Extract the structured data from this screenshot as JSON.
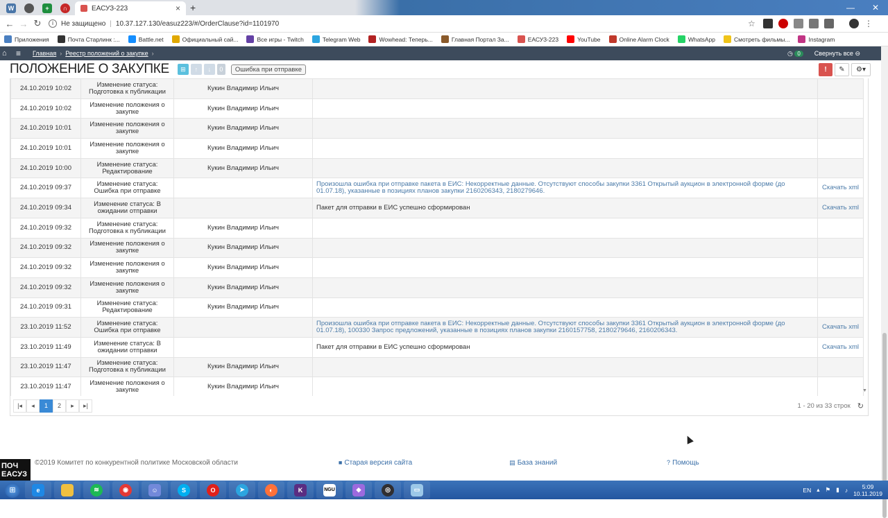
{
  "browser": {
    "active_tab_title": "ЕАСУЗ-223",
    "address_secure": "Не защищено",
    "address_url": "10.37.127.130/easuz223/#/OrderClause?id=1101970"
  },
  "bookmarks": [
    {
      "label": "Приложения",
      "color": "#4a7fc0"
    },
    {
      "label": "Почта Старлинк :...",
      "color": "#333"
    },
    {
      "label": "Battle.net",
      "color": "#148eff"
    },
    {
      "label": "Официальный сай...",
      "color": "#e0a800"
    },
    {
      "label": "Все игры - Twitch",
      "color": "#6441a5"
    },
    {
      "label": "Telegram Web",
      "color": "#2ca5e0"
    },
    {
      "label": "Wowhead: Теперь...",
      "color": "#b22222"
    },
    {
      "label": "Главная Портал За...",
      "color": "#8a5a2b"
    },
    {
      "label": "ЕАСУЗ-223",
      "color": "#d9534f"
    },
    {
      "label": "YouTube",
      "color": "#ff0000"
    },
    {
      "label": "Online Alarm Clock",
      "color": "#c0392b"
    },
    {
      "label": "WhatsApp",
      "color": "#25d366"
    },
    {
      "label": "Смотреть фильмы...",
      "color": "#f0c419"
    },
    {
      "label": "Instagram",
      "color": "#c13584"
    }
  ],
  "app_nav": {
    "crumb_home": "Главная",
    "crumb_registry": "Реестр положений о закупке",
    "counter": "0",
    "collapse_all": "Свернуть все"
  },
  "page": {
    "title": "ПОЛОЖЕНИЕ О ЗАКУПКЕ",
    "status": "Ошибка при отправке"
  },
  "table": {
    "rows": [
      {
        "date": "24.10.2019 10:02",
        "action": "Изменение статуса: Подготовка к публикации",
        "user": "Кукин Владимир Ильич",
        "message": "",
        "download": ""
      },
      {
        "date": "24.10.2019 10:02",
        "action": "Изменение положения о закупке",
        "user": "Кукин Владимир Ильич",
        "message": "",
        "download": ""
      },
      {
        "date": "24.10.2019 10:01",
        "action": "Изменение положения о закупке",
        "user": "Кукин Владимир Ильич",
        "message": "",
        "download": ""
      },
      {
        "date": "24.10.2019 10:01",
        "action": "Изменение положения о закупке",
        "user": "Кукин Владимир Ильич",
        "message": "",
        "download": ""
      },
      {
        "date": "24.10.2019 10:00",
        "action": "Изменение статуса: Редактирование",
        "user": "Кукин Владимир Ильич",
        "message": "",
        "download": ""
      },
      {
        "date": "24.10.2019 09:37",
        "action": "Изменение статуса: Ошибка при отправке",
        "user": "",
        "message": "Произошла ошибка при отправке пакета в ЕИС: Некорректные данные. Отсутствуют способы закупки 3361 Открытый аукцион в электронной форме (до 01.07.18), указанные в позициях планов закупки 2160206343, 2180279646.",
        "download": "Скачать xml"
      },
      {
        "date": "24.10.2019 09:34",
        "action": "Изменение статуса: В ожидании отправки",
        "user": "",
        "message": "Пакет для отправки в ЕИС успешно сформирован",
        "download": "Скачать xml"
      },
      {
        "date": "24.10.2019 09:32",
        "action": "Изменение статуса: Подготовка к публикации",
        "user": "Кукин Владимир Ильич",
        "message": "",
        "download": ""
      },
      {
        "date": "24.10.2019 09:32",
        "action": "Изменение положения о закупке",
        "user": "Кукин Владимир Ильич",
        "message": "",
        "download": ""
      },
      {
        "date": "24.10.2019 09:32",
        "action": "Изменение положения о закупке",
        "user": "Кукин Владимир Ильич",
        "message": "",
        "download": ""
      },
      {
        "date": "24.10.2019 09:32",
        "action": "Изменение положения о закупке",
        "user": "Кукин Владимир Ильич",
        "message": "",
        "download": ""
      },
      {
        "date": "24.10.2019 09:31",
        "action": "Изменение статуса: Редактирование",
        "user": "Кукин Владимир Ильич",
        "message": "",
        "download": ""
      },
      {
        "date": "23.10.2019 11:52",
        "action": "Изменение статуса: Ошибка при отправке",
        "user": "",
        "message": "Произошла ошибка при отправке пакета в ЕИС: Некорректные данные. Отсутствуют способы закупки 3361 Открытый аукцион в электронной форме (до 01.07.18), 100330 Запрос предложений, указанные в позициях планов закупки 2160157758, 2180279646, 2160206343.",
        "download": "Скачать xml"
      },
      {
        "date": "23.10.2019 11:49",
        "action": "Изменение статуса: В ожидании отправки",
        "user": "",
        "message": "Пакет для отправки в ЕИС успешно сформирован",
        "download": "Скачать xml"
      },
      {
        "date": "23.10.2019 11:47",
        "action": "Изменение статуса: Подготовка к публикации",
        "user": "Кукин Владимир Ильич",
        "message": "",
        "download": ""
      },
      {
        "date": "23.10.2019 11:47",
        "action": "Изменение положения о закупке",
        "user": "Кукин Владимир Ильич",
        "message": "",
        "download": ""
      }
    ]
  },
  "pager": {
    "pages": [
      "1",
      "2"
    ],
    "current": "1",
    "info": "1 - 20 из 33 строк"
  },
  "footer": {
    "copyright": "©2019 Комитет по конкурентной политике Московской области",
    "old_version": "Старая версия сайта",
    "knowledge": "База знаний",
    "help": "Помощь"
  },
  "corner_logo": "ПОЧ EACУЗ",
  "taskbar": {
    "lang": "EN",
    "time": "5:09",
    "date": "10.11.2019"
  }
}
